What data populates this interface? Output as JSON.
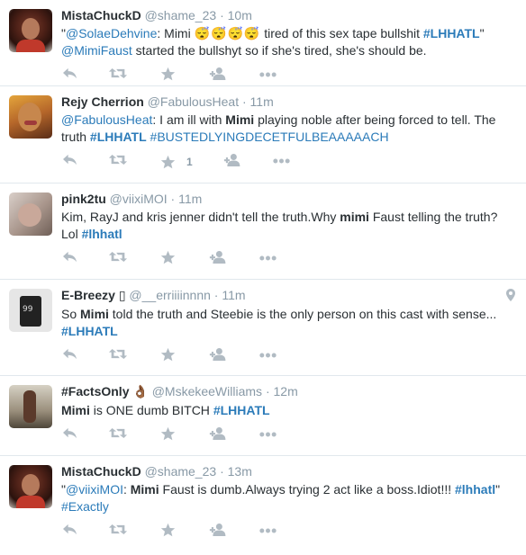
{
  "icons": {
    "reply": "reply-icon",
    "retweet": "retweet-icon",
    "favorite": "star-icon",
    "follow": "follow-icon",
    "more": "more-icon",
    "geo": "location-pin-icon"
  },
  "colors": {
    "link": "#2b7bb9",
    "meta": "#8899a6",
    "icon": "#b1bbc3",
    "divider": "#e1e8ed"
  },
  "tweets": [
    {
      "fullname": "MistaChuckD",
      "username": "@shame_23",
      "time": "10m",
      "avatar": "woman-portrait-avatar",
      "text": {
        "mention1": "@SolaeDehvine",
        "t1": ": Mimi ",
        "emoji": "😴😴😴😴",
        "t2": " tired of this sex tape bullshit ",
        "hashtag": "#LHHATL",
        "t3": "\" ",
        "mention2": "@MimiFaust",
        "t4": " started the bullshyt so if she's tired, she's should be.",
        "open_quote": "\""
      },
      "favorites": ""
    },
    {
      "fullname": "Rejy Cherrion",
      "username": "@FabulousHeat",
      "time": "11m",
      "avatar": "selfie-avatar",
      "text": {
        "mention1": "@FabulousHeat",
        "t1": ": I am ill with ",
        "bold": "Mimi",
        "t2": " playing noble after being forced to tell. The truth ",
        "hashtag1": "#LHHATL",
        "hashtag2": "#BUSTEDLYINGDECETFULBEAAAAACH"
      },
      "favorites": "1"
    },
    {
      "fullname": "pink2tu",
      "username": "@viixiMOI",
      "time": "11m",
      "avatar": "child-photo-avatar",
      "text": {
        "t1": "Kim, RayJ and kris jenner didn't tell the truth.Why ",
        "bold": "mimi",
        "t2": " Faust telling the truth? Lol ",
        "hashtag": "#lhhatl"
      },
      "favorites": ""
    },
    {
      "fullname": "E-Breezy",
      "fullname_glyph": "▯",
      "username": "@__erriiiinnnn",
      "time": "11m",
      "avatar": "phone-screen-avatar",
      "avatar_text": "99",
      "text": {
        "t1": "So ",
        "bold": "Mimi",
        "t2": " told the truth and Steebie is the only person on this cast with sense... ",
        "hashtag": "#LHHATL"
      },
      "favorites": "",
      "has_geo": true
    },
    {
      "fullname": "#FactsOnly",
      "fullname_glyph": "👌🏾",
      "username": "@MskekeeWilliams",
      "time": "12m",
      "avatar": "mirror-selfie-avatar",
      "text": {
        "bold": "Mimi",
        "t1": " is ONE dumb BITCH ",
        "hashtag": "#LHHATL"
      },
      "favorites": ""
    },
    {
      "fullname": "MistaChuckD",
      "username": "@shame_23",
      "time": "13m",
      "avatar": "woman-portrait-avatar",
      "text": {
        "open_quote": "\"",
        "mention1": "@viixiMOI",
        "t0": ": ",
        "bold": "Mimi",
        "t1": " Faust is dumb.Always trying 2 act like a boss.Idiot!!! ",
        "hashtag": "#lhhatl",
        "t2": "\" ",
        "hashtag2": "#Exactly"
      },
      "favorites": ""
    }
  ]
}
